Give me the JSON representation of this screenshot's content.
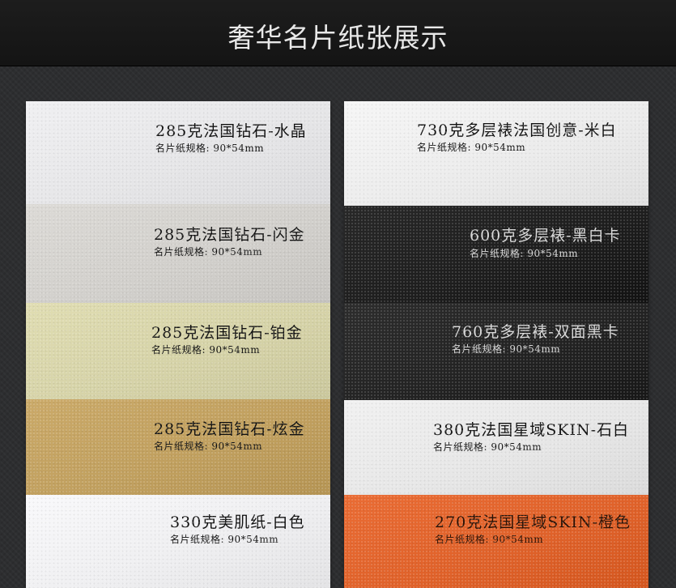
{
  "header": {
    "title": "奢华名片纸张展示"
  },
  "left_cards": [
    {
      "name": "285克法国钻石-水晶",
      "spec": "名片纸规格: 90*54mm",
      "color": "#e6e6e8"
    },
    {
      "name": "285克法国钻石-闪金",
      "spec": "名片纸规格: 90*54mm",
      "color": "#d2d0cc"
    },
    {
      "name": "285克法国钻石-铂金",
      "spec": "名片纸规格: 90*54mm",
      "color": "#d6d3a8"
    },
    {
      "name": "285克法国钻石-炫金",
      "spec": "名片纸规格: 90*54mm",
      "color": "#c1a05f"
    },
    {
      "name": "330克美肌纸-白色",
      "spec": "名片纸规格: 90*54mm",
      "color": "#efeff1"
    }
  ],
  "right_cards": [
    {
      "name": "730克多层裱法国创意-米白",
      "spec": "名片纸规格: 90*54mm",
      "color": "#ececec"
    },
    {
      "name": "600克多层裱-黑白卡",
      "spec": "名片纸规格: 90*54mm",
      "color": "#1e1e1e"
    },
    {
      "name": "760克多层裱-双面黑卡",
      "spec": "名片纸规格: 90*54mm",
      "color": "#232323"
    },
    {
      "name": "380克法国星域SKIN-石白",
      "spec": "名片纸规格: 90*54mm",
      "color": "#e7e7e7"
    },
    {
      "name": "270克法国星域SKIN-橙色",
      "spec": "名片纸规格: 90*54mm",
      "color": "#e0622a"
    }
  ]
}
